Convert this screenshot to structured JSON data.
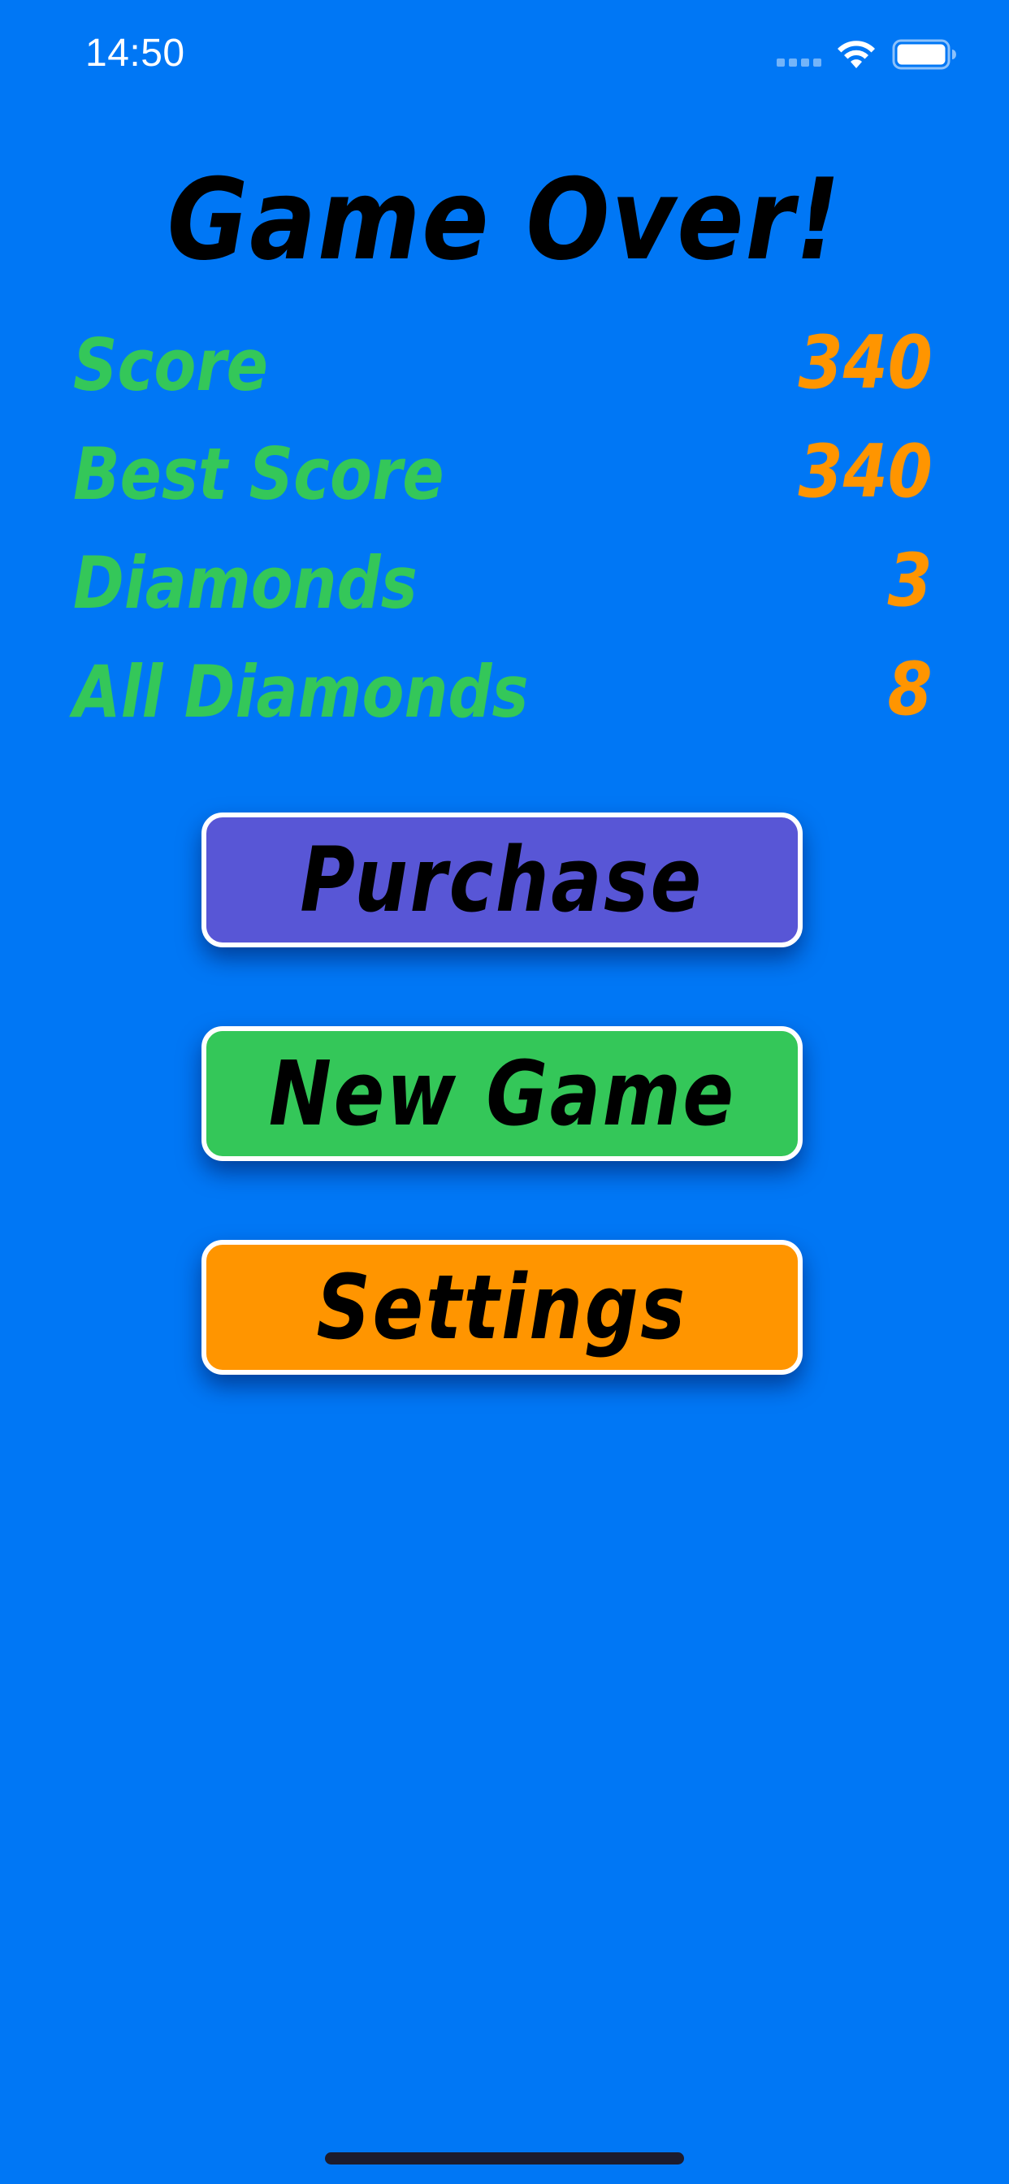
{
  "status_bar": {
    "time": "14:50",
    "signal_icon": "cellular-signal-icon",
    "wifi_icon": "wifi-icon",
    "battery_icon": "battery-icon"
  },
  "title": "Game Over!",
  "stats": [
    {
      "label": "Score",
      "value": "340"
    },
    {
      "label": "Best Score",
      "value": "340"
    },
    {
      "label": "Diamonds",
      "value": "3"
    },
    {
      "label": "All Diamonds",
      "value": "8"
    }
  ],
  "buttons": {
    "purchase": {
      "label": "Purchase",
      "color": "#5856d6"
    },
    "new_game": {
      "label": "New Game",
      "color": "#34c759"
    },
    "settings": {
      "label": "Settings",
      "color": "#ff9500"
    }
  },
  "colors": {
    "background": "#0077f5",
    "stat_label": "#34c759",
    "stat_value": "#ff9500",
    "title": "#000000"
  }
}
